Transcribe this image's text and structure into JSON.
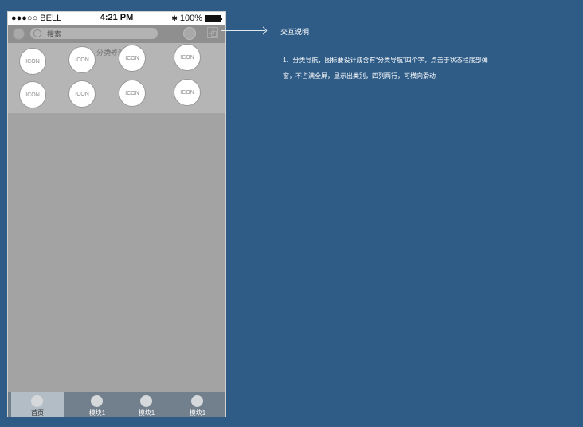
{
  "statusbar": {
    "carrier": "●●●○○ BELL",
    "time": "4:21 PM",
    "battery": "100%"
  },
  "topbar": {
    "search_placeholder": "搜索"
  },
  "panel": {
    "title": "分类导航",
    "icons": [
      "ICON",
      "ICON",
      "ICON",
      "ICON",
      "ICON",
      "ICON",
      "ICON",
      "ICON"
    ]
  },
  "tabbar": {
    "tabs": [
      "首页",
      "模块1",
      "模块1",
      "模块1"
    ]
  },
  "annotation": {
    "title": "交互说明",
    "text": "1、分类导航，图标要设计成含有“分类导航”四个字，点击于状态栏底部弹窗，不占满全屏，显示出类别，四列两行，可横向滑动"
  }
}
